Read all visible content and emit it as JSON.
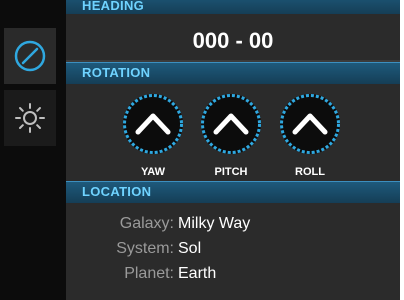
{
  "tabs": [
    {
      "icon": "compass-icon",
      "active": true
    },
    {
      "icon": "sun-icon",
      "active": false
    }
  ],
  "heading": {
    "label": "HEADING",
    "value": "000 - 00"
  },
  "rotation": {
    "label": "ROTATION",
    "controls": [
      {
        "label": "YAW",
        "icon": "chevron-up-icon"
      },
      {
        "label": "PITCH",
        "icon": "chevron-up-icon"
      },
      {
        "label": "ROLL",
        "icon": "chevron-up-icon"
      }
    ]
  },
  "location": {
    "label": "LOCATION",
    "rows": [
      {
        "key": "Galaxy:",
        "value": "Milky Way"
      },
      {
        "key": "System:",
        "value": "Sol"
      },
      {
        "key": "Planet:",
        "value": "Earth"
      }
    ]
  },
  "colors": {
    "accent": "#2fa8e0",
    "header_text": "#6fd3ff",
    "panel_bg": "#2b2b2b"
  }
}
